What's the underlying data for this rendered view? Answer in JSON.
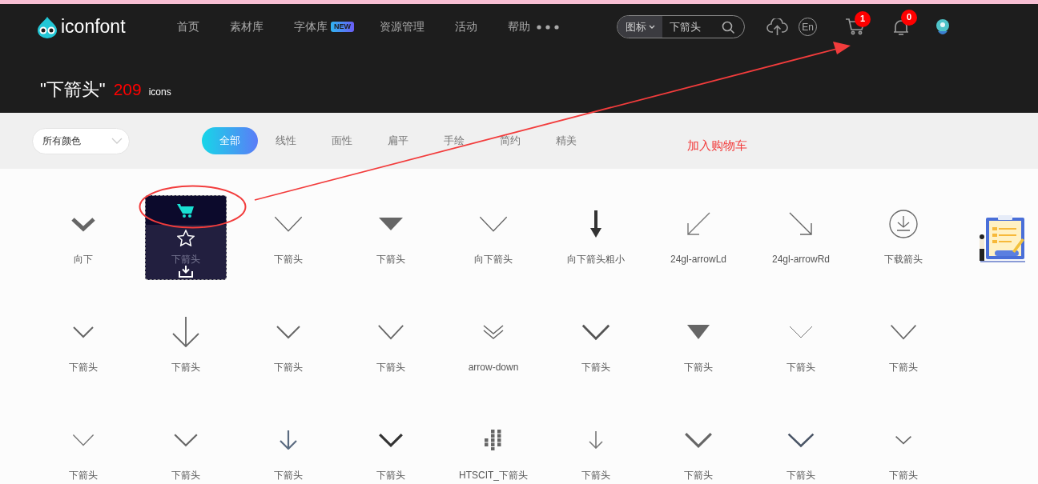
{
  "header": {
    "logo": "iconfont",
    "nav": [
      {
        "label": "首页"
      },
      {
        "label": "素材库"
      },
      {
        "label": "字体库",
        "badge": "NEW"
      },
      {
        "label": "资源管理"
      },
      {
        "label": "活动"
      },
      {
        "label": "帮助"
      }
    ],
    "search": {
      "scope": "图标",
      "value": "下箭头"
    },
    "language": "En",
    "cart_count": "1",
    "notification_count": "0"
  },
  "results": {
    "query": "\"下箭头\"",
    "count": "209",
    "unit": "icons"
  },
  "filters": {
    "color_filter_label": "所有颜色",
    "styles": [
      {
        "label": "全部",
        "selected": true
      },
      {
        "label": "线性",
        "selected": false
      },
      {
        "label": "面性",
        "selected": false
      },
      {
        "label": "扁平",
        "selected": false
      },
      {
        "label": "手绘",
        "selected": false
      },
      {
        "label": "简约",
        "selected": false
      },
      {
        "label": "精美",
        "selected": false
      }
    ]
  },
  "icon_rows": [
    [
      {
        "name": "向下",
        "hovered": false
      },
      {
        "name": "下箭头",
        "hovered": true
      },
      {
        "name": "下箭头",
        "hovered": false
      },
      {
        "name": "下箭头",
        "hovered": false
      },
      {
        "name": "向下箭头",
        "hovered": false
      },
      {
        "name": "向下箭头粗小",
        "hovered": false
      },
      {
        "name": "24gl-arrowLd",
        "hovered": false
      },
      {
        "name": "24gl-arrowRd",
        "hovered": false
      },
      {
        "name": "下载箭头",
        "hovered": false
      }
    ],
    [
      {
        "name": "下箭头",
        "hovered": false
      },
      {
        "name": "下箭头",
        "hovered": false
      },
      {
        "name": "下箭头",
        "hovered": false
      },
      {
        "name": "下箭头",
        "hovered": false
      },
      {
        "name": "arrow-down",
        "hovered": false
      },
      {
        "name": "下箭头",
        "hovered": false
      },
      {
        "name": "下箭头",
        "hovered": false
      },
      {
        "name": "下箭头",
        "hovered": false
      },
      {
        "name": "下箭头",
        "hovered": false
      }
    ],
    [
      {
        "name": "下箭头",
        "hovered": false
      },
      {
        "name": "下箭头",
        "hovered": false
      },
      {
        "name": "下箭头",
        "hovered": false
      },
      {
        "name": "下箭头",
        "hovered": false
      },
      {
        "name": "HTSCIT_下箭头",
        "hovered": false
      },
      {
        "name": "下箭头",
        "hovered": false
      },
      {
        "name": "下箭头",
        "hovered": false
      },
      {
        "name": "下箭头",
        "hovered": false
      },
      {
        "name": "下箭头",
        "hovered": false
      }
    ]
  ],
  "annotation": {
    "text": "加入购物车"
  }
}
